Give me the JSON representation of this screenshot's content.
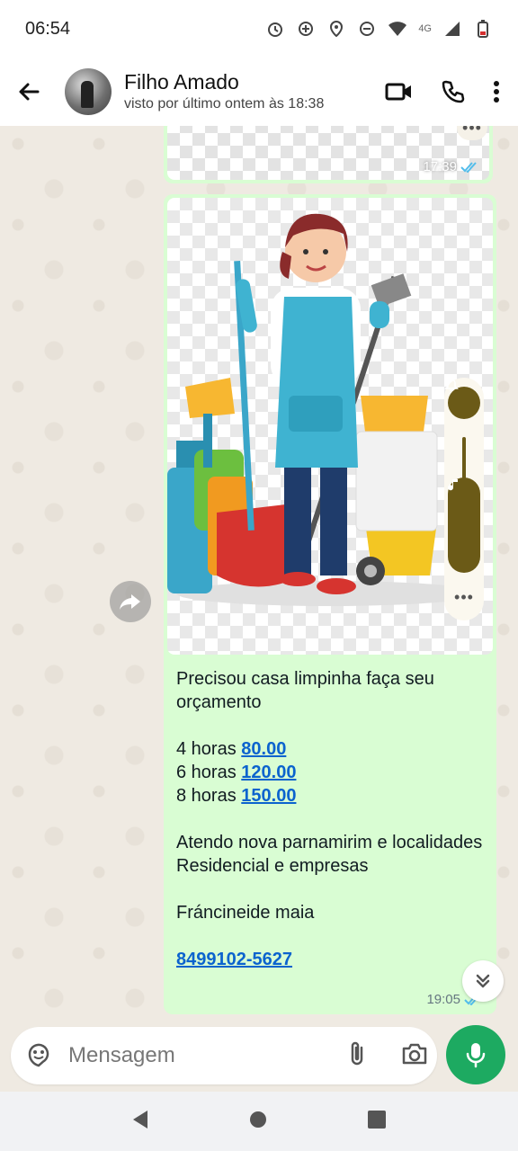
{
  "status_bar": {
    "time": "06:54",
    "network": "4G"
  },
  "header": {
    "contact_name": "Filho Amado",
    "contact_status": "visto por último ontem às 18:38"
  },
  "messages": {
    "previous_time": "17:39",
    "main": {
      "line1": "Precisou casa limpinha faça seu orçamento",
      "prices": [
        {
          "label": "4 horas",
          "value": "80.00"
        },
        {
          "label": "6 horas",
          "value": "120.00"
        },
        {
          "label": "8 horas",
          "value": "150.00"
        }
      ],
      "line_area1": "Atendo nova parnamirim e localidades",
      "line_area2": "Residencial e empresas",
      "signature": "Fráncineide maia",
      "phone": "8499102-5627",
      "time": "19:05"
    }
  },
  "input": {
    "placeholder": "Mensagem"
  },
  "colors": {
    "bubble_outgoing": "#d9fdd3",
    "accent_green": "#1daa61",
    "link_blue": "#0b63ce",
    "read_tick_blue": "#53bdeb"
  },
  "icons": {
    "back": "arrow-left-icon",
    "video": "video-call-icon",
    "call": "phone-icon",
    "menu": "more-vertical-icon",
    "emoji": "sticker-icon",
    "attach": "paperclip-icon",
    "camera": "camera-icon",
    "mic": "mic-icon"
  }
}
